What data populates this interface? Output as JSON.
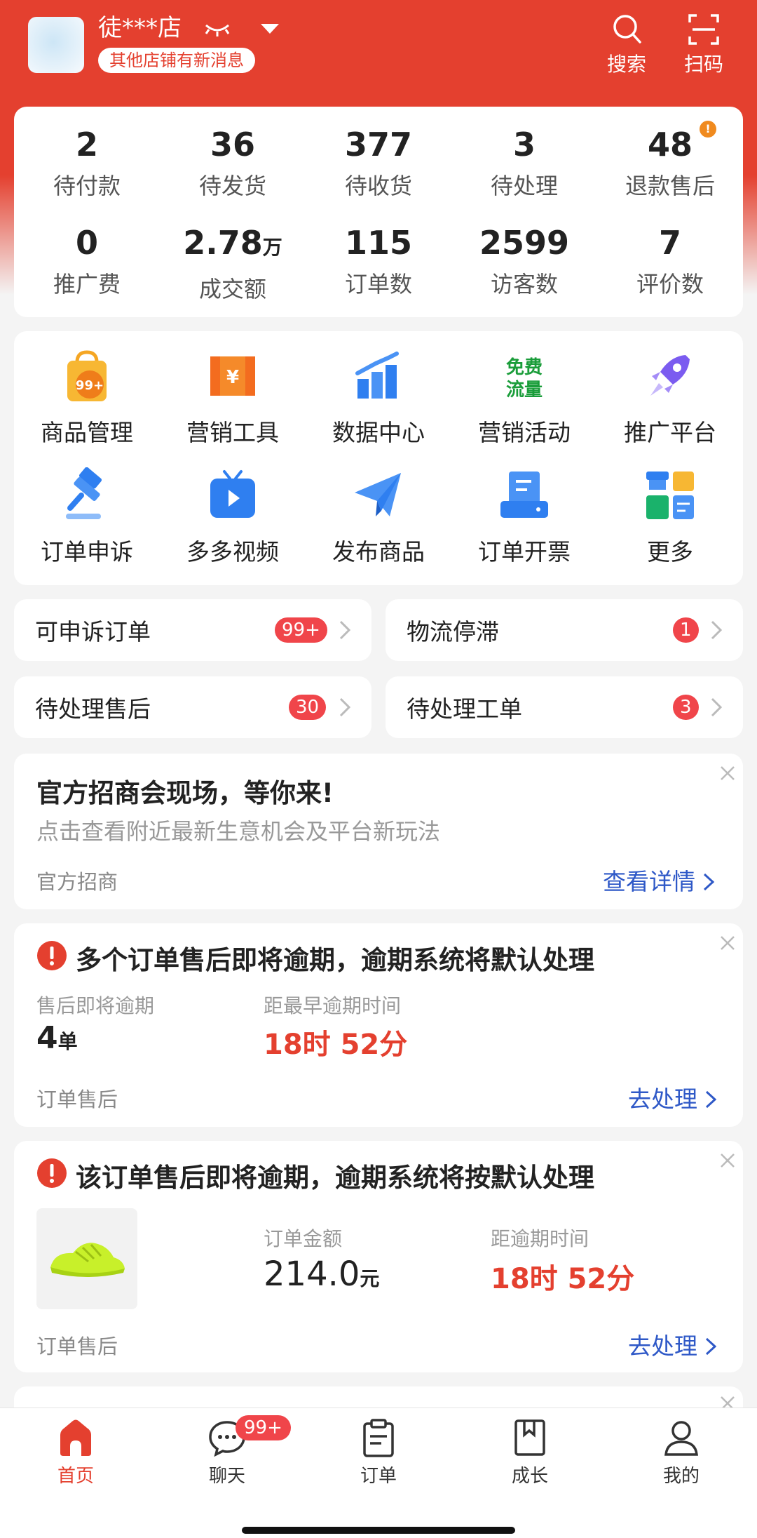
{
  "header": {
    "shop_name": "徒***店",
    "message_badge": "其他店铺有新消息",
    "search_label": "搜索",
    "scan_label": "扫码"
  },
  "stats": [
    {
      "value": "2",
      "unit": "",
      "label": "待付款"
    },
    {
      "value": "36",
      "unit": "",
      "label": "待发货"
    },
    {
      "value": "377",
      "unit": "",
      "label": "待收货"
    },
    {
      "value": "3",
      "unit": "",
      "label": "待处理"
    },
    {
      "value": "48",
      "unit": "",
      "label": "退款售后",
      "badge": "!"
    },
    {
      "value": "0",
      "unit": "",
      "label": "推广费"
    },
    {
      "value": "2.78",
      "unit": "万",
      "label": "成交额"
    },
    {
      "value": "115",
      "unit": "",
      "label": "订单数"
    },
    {
      "value": "2599",
      "unit": "",
      "label": "访客数"
    },
    {
      "value": "7",
      "unit": "",
      "label": "评价数"
    }
  ],
  "tools": [
    {
      "label": "商品管理",
      "icon": "bag-99-icon",
      "badge": "99+"
    },
    {
      "label": "营销工具",
      "icon": "coupon-icon"
    },
    {
      "label": "数据中心",
      "icon": "bar-chart-icon"
    },
    {
      "label": "营销活动",
      "icon": "free-traffic-icon",
      "icon_text": [
        "免费",
        "流量"
      ]
    },
    {
      "label": "推广平台",
      "icon": "rocket-icon"
    },
    {
      "label": "订单申诉",
      "icon": "gavel-icon"
    },
    {
      "label": "多多视频",
      "icon": "video-icon"
    },
    {
      "label": "发布商品",
      "icon": "paper-plane-icon"
    },
    {
      "label": "订单开票",
      "icon": "invoice-printer-icon"
    },
    {
      "label": "更多",
      "icon": "more-grid-icon"
    }
  ],
  "shortcuts": [
    {
      "label": "可申诉订单",
      "count": "99+"
    },
    {
      "label": "物流停滞",
      "count": "1"
    },
    {
      "label": "待处理售后",
      "count": "30"
    },
    {
      "label": "待处理工单",
      "count": "3"
    }
  ],
  "notices": {
    "recruit": {
      "title": "官方招商会现场，等你来!",
      "subtitle": "点击查看附近最新生意机会及平台新玩法",
      "footer_left": "官方招商",
      "action": "查看详情"
    },
    "overdue_multi": {
      "title": "多个订单售后即将逾期，逾期系统将默认处理",
      "left_label": "售后即将逾期",
      "left_value": "4",
      "left_unit": "单",
      "right_label": "距最早逾期时间",
      "right_value": "18时 52分",
      "footer_left": "订单售后",
      "action": "去处理"
    },
    "overdue_single": {
      "title": "该订单售后即将逾期，逾期系统将按默认处理",
      "amount_label": "订单金额",
      "amount_value": "214.0",
      "amount_unit": "元",
      "time_label": "距逾期时间",
      "time_value": "18时 52分",
      "footer_left": "订单售后",
      "action": "去处理"
    }
  },
  "bottom_nav": {
    "items": [
      {
        "label": "首页",
        "icon": "home-icon",
        "active": true
      },
      {
        "label": "聊天",
        "icon": "chat-icon",
        "badge": "99+"
      },
      {
        "label": "订单",
        "icon": "clipboard-icon"
      },
      {
        "label": "成长",
        "icon": "book-icon"
      },
      {
        "label": "我的",
        "icon": "profile-icon"
      }
    ]
  },
  "colors": {
    "brand_red": "#e4402f",
    "link_blue": "#2e58c7",
    "badge_red": "#f0454a"
  }
}
